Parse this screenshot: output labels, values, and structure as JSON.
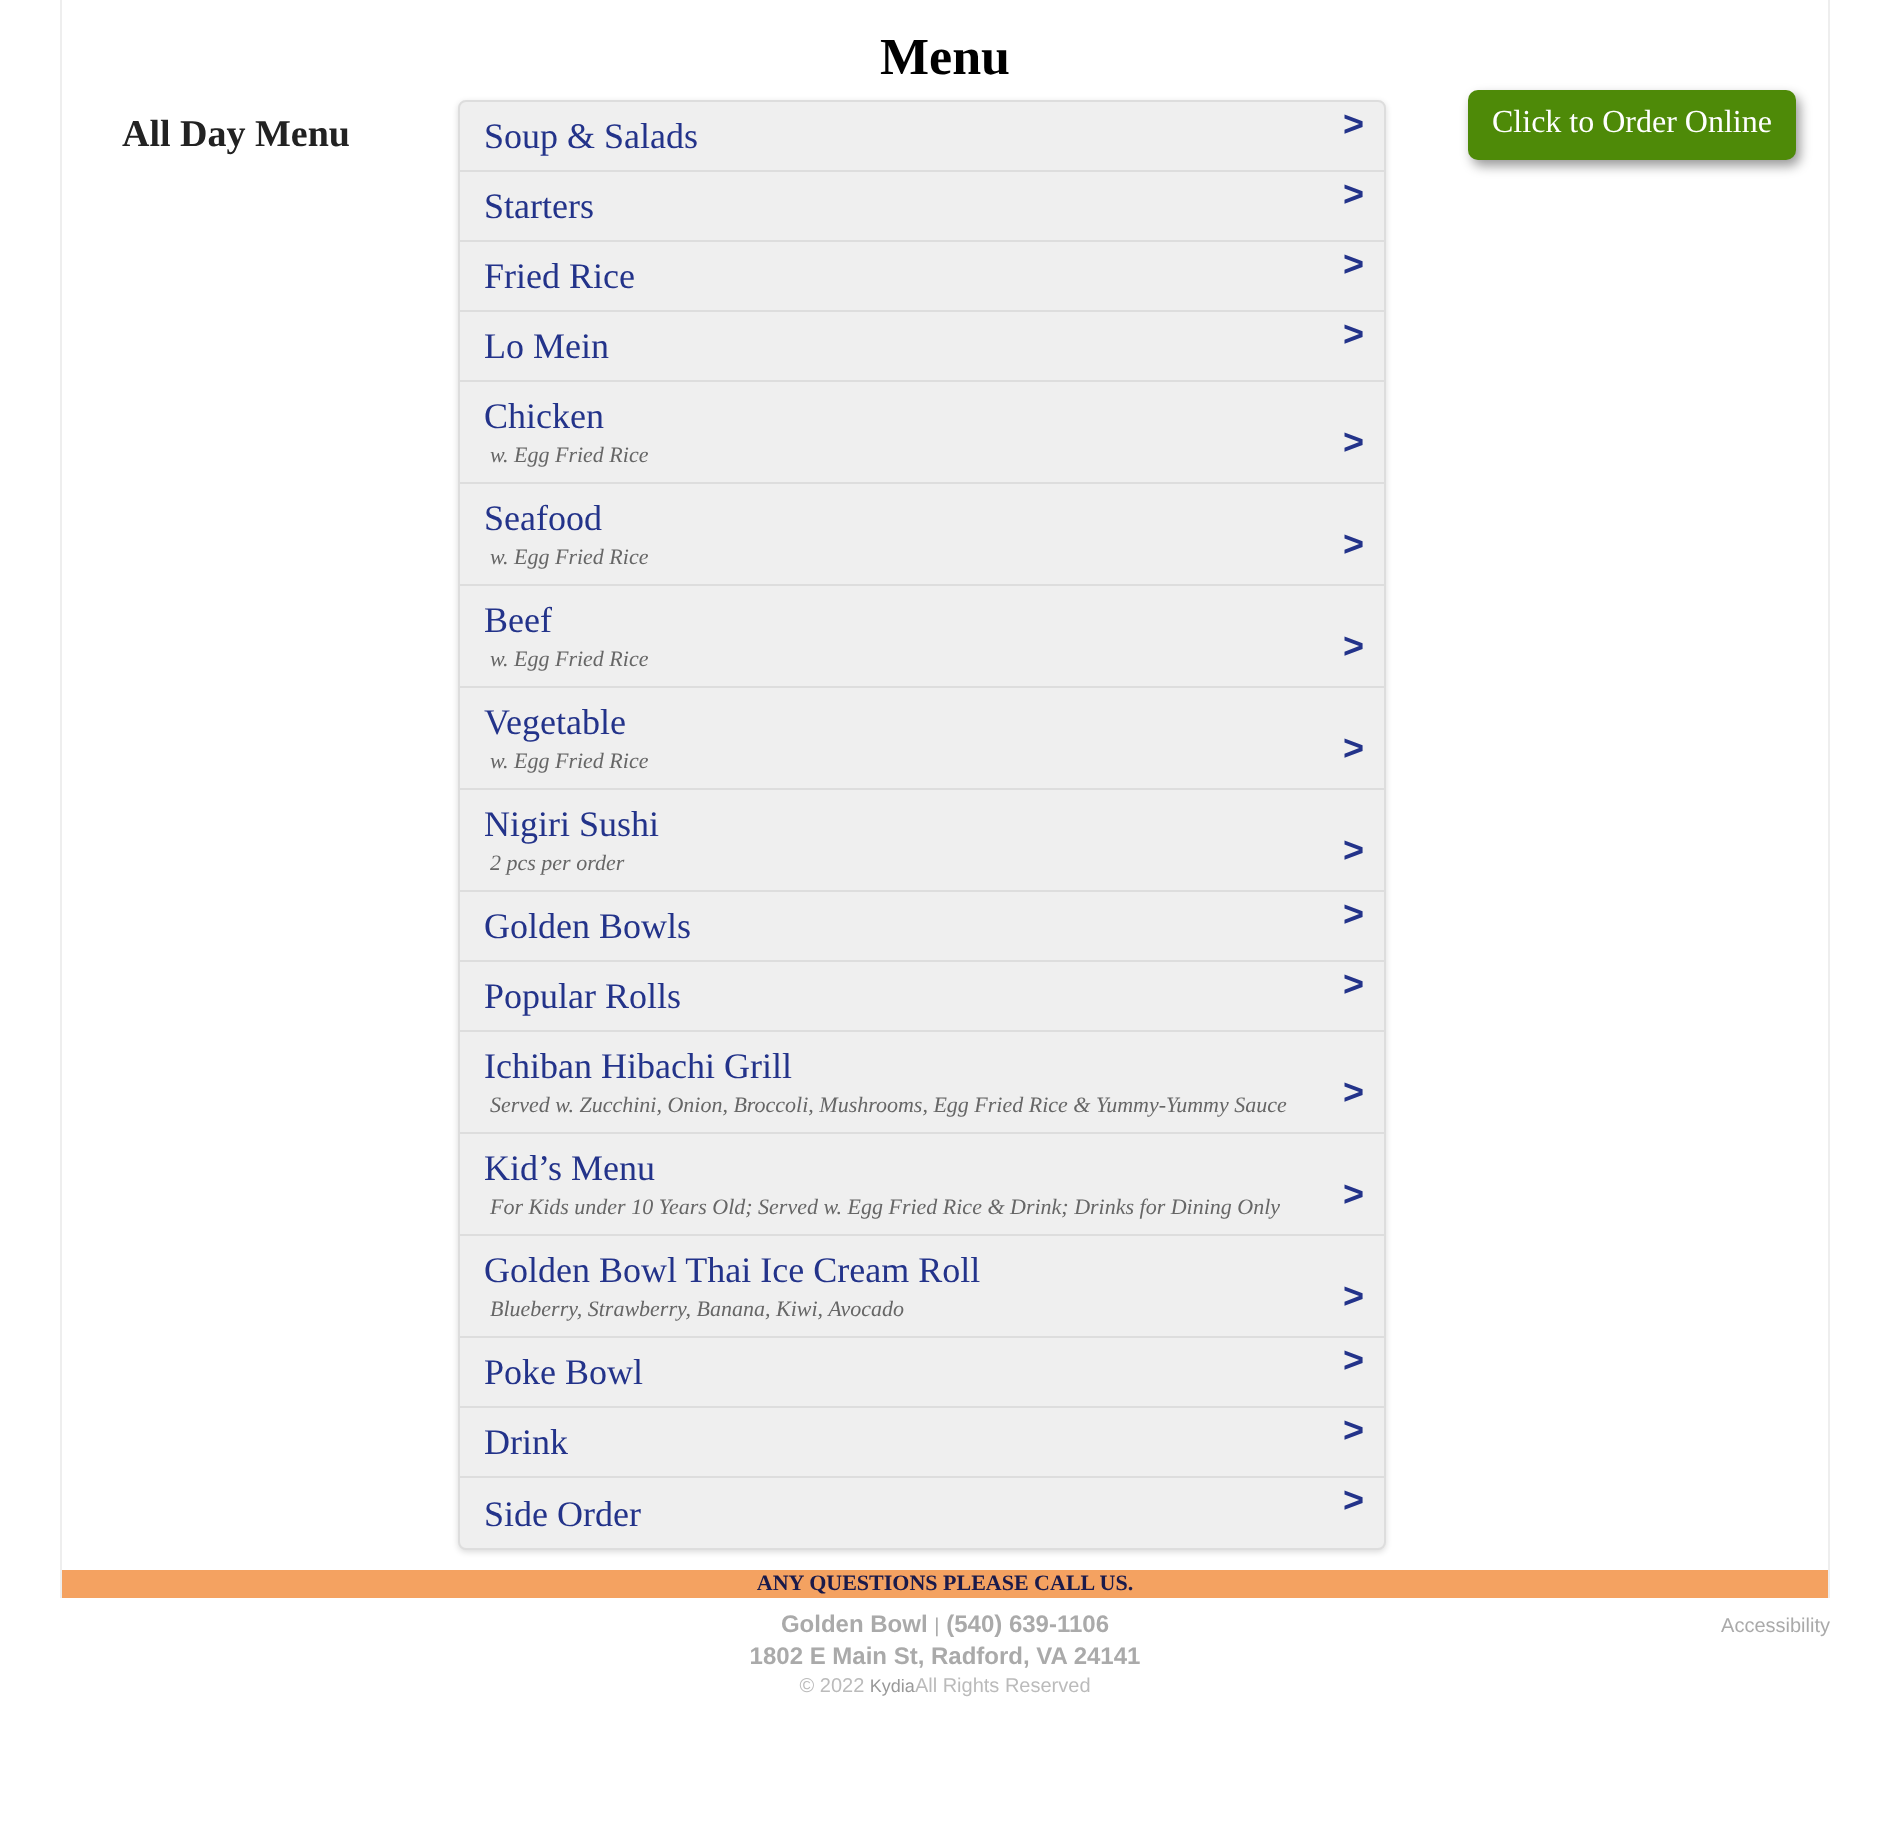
{
  "title": "Menu",
  "sidebar": {
    "heading": "All Day Menu"
  },
  "categories": [
    {
      "name": "Soup & Salads",
      "arrow": ">"
    },
    {
      "name": "Starters",
      "arrow": ">"
    },
    {
      "name": "Fried Rice",
      "arrow": ">"
    },
    {
      "name": "Lo Mein",
      "arrow": ">"
    },
    {
      "name": "Chicken",
      "note": "w. Egg Fried Rice",
      "arrow": ">"
    },
    {
      "name": "Seafood",
      "note": "w. Egg Fried Rice",
      "arrow": ">"
    },
    {
      "name": "Beef",
      "note": "w. Egg Fried Rice",
      "arrow": ">"
    },
    {
      "name": "Vegetable",
      "note": "w. Egg Fried Rice",
      "arrow": ">"
    },
    {
      "name": "Nigiri Sushi",
      "note": "2 pcs per order",
      "arrow": ">"
    },
    {
      "name": "Golden Bowls",
      "arrow": ">"
    },
    {
      "name": "Popular Rolls",
      "arrow": ">"
    },
    {
      "name": "Ichiban Hibachi Grill",
      "note": "Served w. Zucchini, Onion, Broccoli, Mushrooms, Egg Fried Rice & Yummy-Yummy Sauce",
      "arrow": ">"
    },
    {
      "name": "Kid’s Menu",
      "note": "For Kids under 10 Years Old; Served w. Egg Fried Rice & Drink; Drinks for Dining Only",
      "arrow": ">"
    },
    {
      "name": "Golden Bowl Thai Ice Cream Roll",
      "note": "Blueberry, Strawberry, Banana, Kiwi, Avocado",
      "arrow": ">"
    },
    {
      "name": "Poke Bowl",
      "arrow": ">"
    },
    {
      "name": "Drink",
      "arrow": ">"
    },
    {
      "name": "Side Order",
      "arrow": ">"
    }
  ],
  "order_button": "Click to Order Online",
  "banner": "ANY QUESTIONS PLEASE CALL US.",
  "footer": {
    "name": "Golden Bowl",
    "separator": "|",
    "phone": "(540) 639-1106",
    "address": "1802 E Main St, Radford, VA 24141",
    "copyright": "© 2022",
    "credit": "Kydia",
    "rights": "All Rights Reserved",
    "accessibility": "Accessibility"
  }
}
